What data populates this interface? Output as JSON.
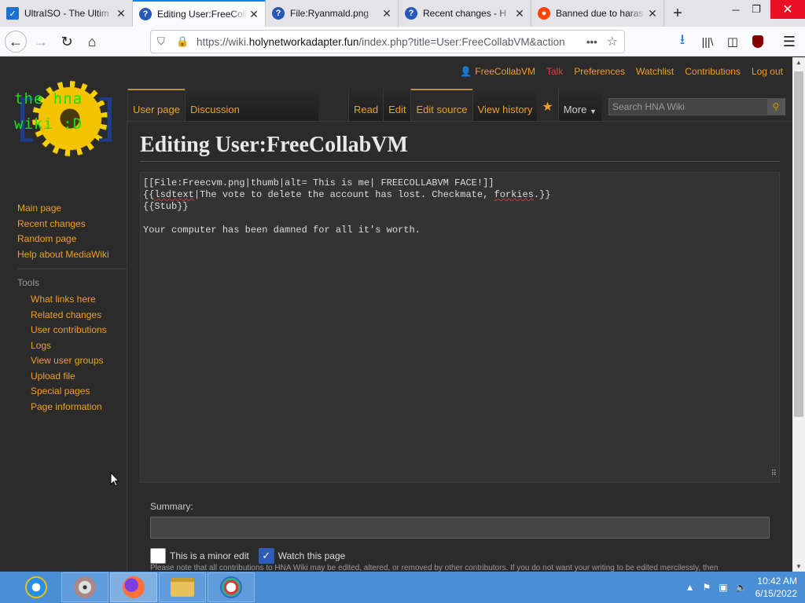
{
  "browser": {
    "tabs": [
      {
        "title": "UltraISO - The Ultim",
        "icon": "ultraiso-icon",
        "active": false
      },
      {
        "title": "Editing User:FreeColl",
        "icon": "wiki-icon",
        "active": true
      },
      {
        "title": "File:Ryanmald.png",
        "icon": "wiki-icon",
        "active": false
      },
      {
        "title": "Recent changes - H",
        "icon": "wiki-icon",
        "active": false
      },
      {
        "title": "Banned due to haras",
        "icon": "reddit-icon",
        "active": false
      }
    ],
    "url_prefix": "https://wiki.",
    "url_domain": "holynetworkadapter.fun",
    "url_rest": "/index.php?title=User:FreeCollabVM&action"
  },
  "wiki": {
    "personal": {
      "username": "FreeCollabVM",
      "talk": "Talk",
      "preferences": "Preferences",
      "watchlist": "Watchlist",
      "contributions": "Contributions",
      "logout": "Log out"
    },
    "logo_text_line1": "the hna",
    "logo_text_line2": "wiki :D",
    "namespace_tabs": {
      "user_page": "User page",
      "discussion": "Discussion"
    },
    "view_tabs": {
      "read": "Read",
      "edit": "Edit",
      "edit_source": "Edit source",
      "view_history": "View history",
      "more": "More"
    },
    "search_placeholder": "Search HNA Wiki",
    "nav": {
      "main_page": "Main page",
      "recent_changes": "Recent changes",
      "random_page": "Random page",
      "help": "Help about MediaWiki"
    },
    "tools_heading": "Tools",
    "tools": {
      "what_links_here": "What links here",
      "related_changes": "Related changes",
      "user_contributions": "User contributions",
      "logs": "Logs",
      "view_user_groups": "View user groups",
      "upload_file": "Upload file",
      "special_pages": "Special pages",
      "page_information": "Page information"
    },
    "page_title": "Editing User:FreeCollabVM",
    "editor": {
      "line1": "[[File:Freecvm.png|thumb|alt= This is me| FREECOLLABVM FACE!]]",
      "line2_a": "{{",
      "line2_b": "lsdtext",
      "line2_c": "|The vote to delete the account has lost. Checkmate, ",
      "line2_d": "forkies",
      "line2_e": ".}}",
      "line3": "{{Stub}}",
      "line5": "Your computer has been damned for all it's worth."
    },
    "summary_label": "Summary:",
    "minor_edit_label": "This is a minor edit",
    "watch_label": "Watch this page",
    "notice": "Please note that all contributions to HNA Wiki may be edited, altered, or removed by other contributors. If you do not want your writing to be edited mercilessly, then"
  },
  "taskbar": {
    "time": "10:42 AM",
    "date": "6/15/2022"
  }
}
